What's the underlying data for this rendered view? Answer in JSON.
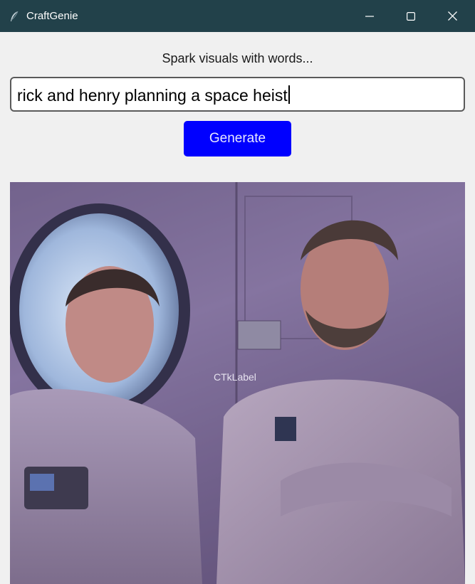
{
  "window": {
    "title": "CraftGenie",
    "icon": "feather-icon",
    "controls": [
      "minimize-icon",
      "maximize-icon",
      "close-icon"
    ]
  },
  "prompt": {
    "label": "Spark visuals with words...",
    "value": "rick and henry planning a space heist"
  },
  "generate_button": {
    "label": "Generate"
  },
  "image": {
    "overlay_label": "CTkLabel",
    "description_icon": "generated-image"
  },
  "colors": {
    "titlebar": "#22414a",
    "window_bg": "#f0f0f0",
    "button_accent": "#0000ff"
  }
}
